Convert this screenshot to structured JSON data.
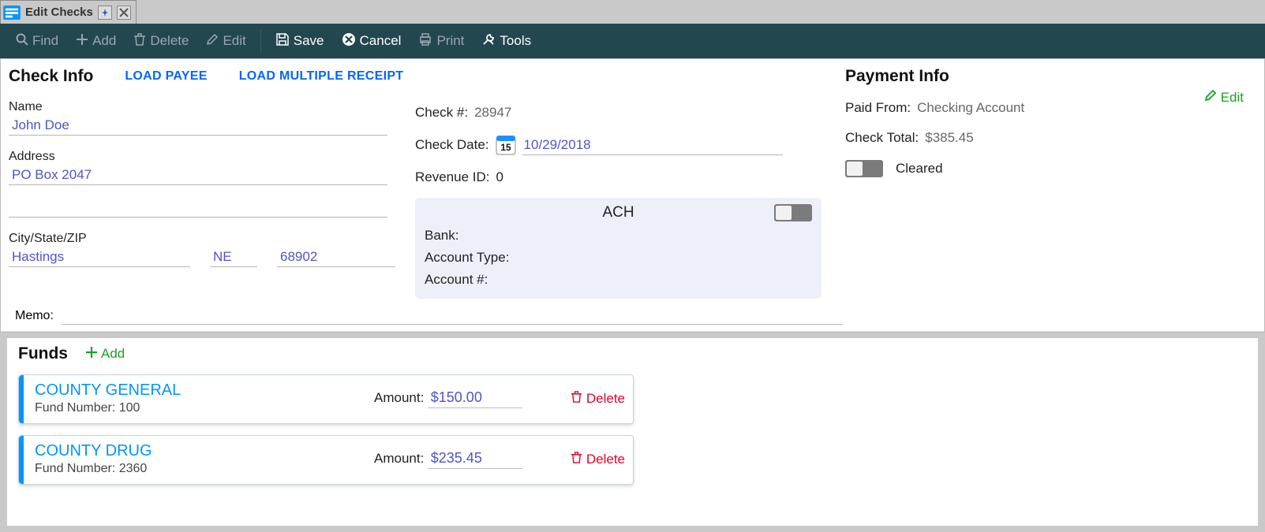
{
  "tab": {
    "title": "Edit Checks"
  },
  "toolbar": {
    "find": "Find",
    "add": "Add",
    "delete": "Delete",
    "edit": "Edit",
    "save": "Save",
    "cancel": "Cancel",
    "print": "Print",
    "tools": "Tools"
  },
  "checkInfo": {
    "title": "Check Info",
    "loadPayee": "LOAD PAYEE",
    "loadMulti": "LOAD MULTIPLE RECEIPT",
    "nameLabel": "Name",
    "name": "John Doe",
    "addressLabel": "Address",
    "address1": "PO Box 2047",
    "address2": "",
    "cszLabel": "City/State/ZIP",
    "city": "Hastings",
    "state": "NE",
    "zip": "68902",
    "memoLabel": "Memo:",
    "memo": ""
  },
  "checkMeta": {
    "checkNumLabel": "Check #:",
    "checkNum": "28947",
    "checkDateLabel": "Check Date:",
    "checkDate": "10/29/2018",
    "revIdLabel": "Revenue ID:",
    "revId": "0",
    "achTitle": "ACH",
    "bankLabel": "Bank:",
    "bank": "",
    "acctTypeLabel": "Account Type:",
    "acctType": "",
    "acctNumLabel": "Account #:",
    "acctNum": ""
  },
  "payment": {
    "title": "Payment Info",
    "paidFromLabel": "Paid From:",
    "paidFrom": "Checking Account",
    "editLabel": "Edit",
    "totalLabel": "Check Total:",
    "total": "$385.45",
    "clearedLabel": "Cleared"
  },
  "fundsSection": {
    "title": "Funds",
    "addLabel": "Add",
    "deleteLabel": "Delete",
    "amountLabel": "Amount:",
    "fundNumPrefix": "Fund Number: "
  },
  "funds": [
    {
      "name": "COUNTY GENERAL",
      "number": "100",
      "amount": "$150.00"
    },
    {
      "name": "COUNTY DRUG",
      "number": "2360",
      "amount": "$235.45"
    }
  ]
}
